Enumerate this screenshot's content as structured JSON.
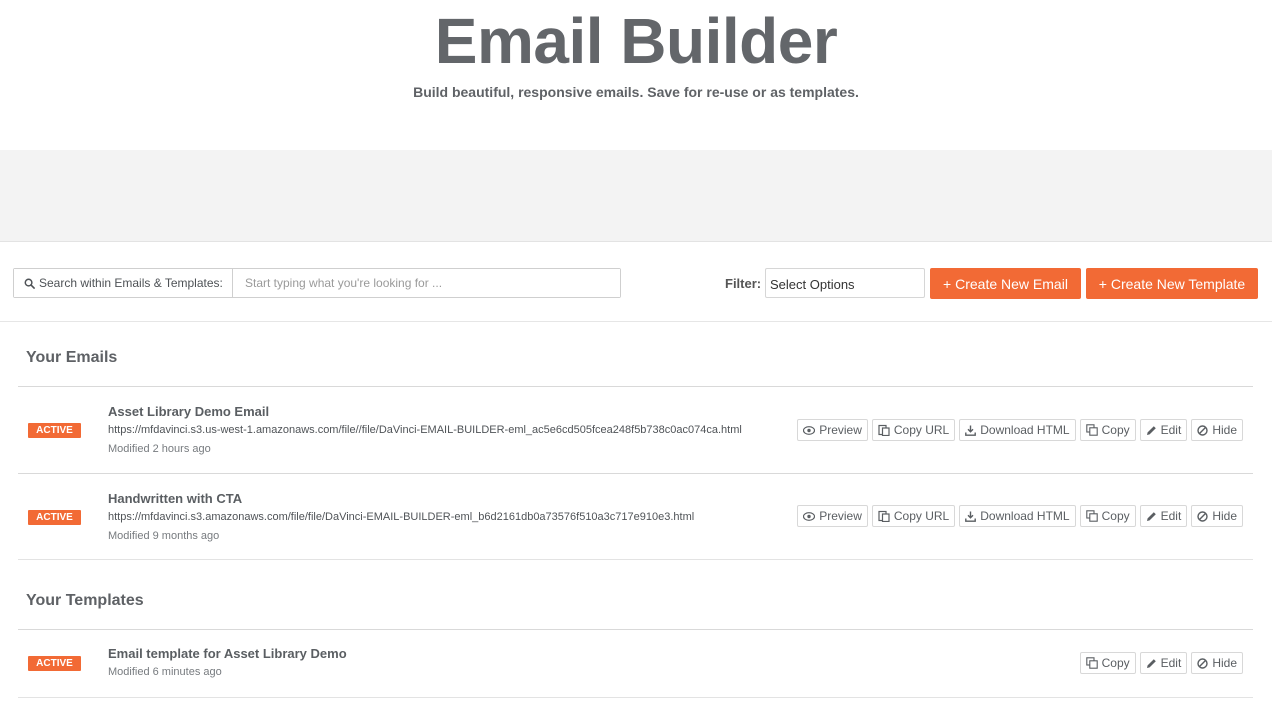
{
  "header": {
    "title": "Email Builder",
    "subtitle": "Build beautiful, responsive emails. Save for re-use or as templates."
  },
  "toolbar": {
    "search_label": "Search within Emails & Templates:",
    "search_placeholder": "Start typing what you're looking for ...",
    "search_value": "",
    "filter_label": "Filter:",
    "filter_value": "Select Options",
    "create_email_label": "+ Create New Email",
    "create_template_label": "+ Create New Template"
  },
  "emails": {
    "heading": "Your Emails",
    "items": [
      {
        "status": "ACTIVE",
        "title": "Asset Library Demo Email",
        "url": "https://mfdavinci.s3.us-west-1.amazonaws.com/file//file/DaVinci-EMAIL-BUILDER-eml_ac5e6cd505fcea248f5b738c0ac074ca.html",
        "modified": "Modified 2 hours ago"
      },
      {
        "status": "ACTIVE",
        "title": "Handwritten with CTA",
        "url": "https://mfdavinci.s3.amazonaws.com/file/file/DaVinci-EMAIL-BUILDER-eml_b6d2161db0a73576f510a3c717e910e3.html",
        "modified": "Modified 9 months ago"
      }
    ]
  },
  "templates": {
    "heading": "Your Templates",
    "items": [
      {
        "status": "ACTIVE",
        "title": "Email template for Asset Library Demo",
        "modified": "Modified 6 minutes ago"
      }
    ]
  },
  "actions": {
    "preview": "Preview",
    "copy_url": "Copy URL",
    "download_html": "Download HTML",
    "copy": "Copy",
    "edit": "Edit",
    "hide": "Hide"
  },
  "colors": {
    "accent": "#f26a35",
    "band": "#f3f3f3",
    "title_text": "#63666a"
  }
}
